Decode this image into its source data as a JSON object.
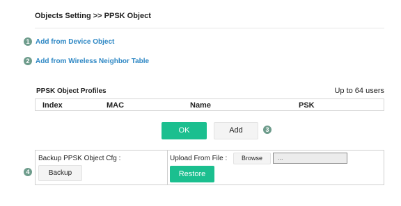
{
  "header": {
    "title": "Objects Setting >> PPSK Object"
  },
  "steps": {
    "one": "1",
    "two": "2",
    "three": "3",
    "four": "4"
  },
  "links": {
    "device_object": "Add from Device Object",
    "wireless_neighbor": "Add from Wireless Neighbor Table"
  },
  "profiles": {
    "title": "PPSK Object Profiles",
    "limit": "Up to 64 users",
    "columns": [
      "Index",
      "MAC",
      "Name",
      "PSK"
    ]
  },
  "actions": {
    "ok": "OK",
    "add": "Add"
  },
  "backup": {
    "label": "Backup PPSK Object Cfg :",
    "backup_button": "Backup",
    "upload_label": "Upload From File :",
    "browse_button": "Browse",
    "file_value": "...",
    "restore_button": "Restore"
  },
  "colors": {
    "accent_green": "#1bbf8f",
    "link_blue": "#2d87c4",
    "step_badge": "#6e9c8c"
  }
}
